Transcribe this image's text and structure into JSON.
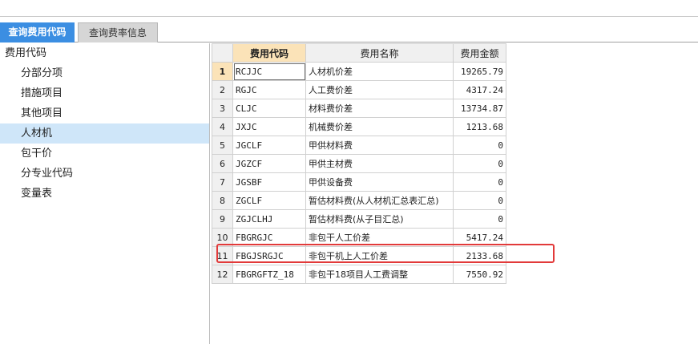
{
  "tabs": [
    {
      "label": "查询费用代码",
      "active": true
    },
    {
      "label": "查询费率信息",
      "active": false
    }
  ],
  "tree": {
    "root": "费用代码",
    "items": [
      "分部分项",
      "措施项目",
      "其他项目",
      "人材机",
      "包干价",
      "分专业代码",
      "变量表"
    ],
    "selected_index": 3
  },
  "grid": {
    "headers": {
      "code": "费用代码",
      "name": "费用名称",
      "amount": "费用金额"
    },
    "rows": [
      {
        "num": "1",
        "code": "RCJJC",
        "name": "人材机价差",
        "amount": "19265.79"
      },
      {
        "num": "2",
        "code": "RGJC",
        "name": "人工费价差",
        "amount": "4317.24"
      },
      {
        "num": "3",
        "code": "CLJC",
        "name": "材料费价差",
        "amount": "13734.87"
      },
      {
        "num": "4",
        "code": "JXJC",
        "name": "机械费价差",
        "amount": "1213.68"
      },
      {
        "num": "5",
        "code": "JGCLF",
        "name": "甲供材料费",
        "amount": "0"
      },
      {
        "num": "6",
        "code": "JGZCF",
        "name": "甲供主材费",
        "amount": "0"
      },
      {
        "num": "7",
        "code": "JGSBF",
        "name": "甲供设备费",
        "amount": "0"
      },
      {
        "num": "8",
        "code": "ZGCLF",
        "name": "暂估材料费(从人材机汇总表汇总)",
        "amount": "0"
      },
      {
        "num": "9",
        "code": "ZGJCLHJ",
        "name": "暂估材料费(从子目汇总)",
        "amount": "0"
      },
      {
        "num": "10",
        "code": "FBGRGJC",
        "name": "非包干人工价差",
        "amount": "5417.24"
      },
      {
        "num": "11",
        "code": "FBGJSRGJC",
        "name": "非包干机上人工价差",
        "amount": "2133.68"
      },
      {
        "num": "12",
        "code": "FBGRGFTZ_18",
        "name": "非包干18项目人工费调整",
        "amount": "7550.92"
      }
    ]
  },
  "colors": {
    "tab_active": "#3b8ee2",
    "selection": "#cfe6f9",
    "sorted_header": "#fbe3b8",
    "highlight": "#e23a3a"
  }
}
